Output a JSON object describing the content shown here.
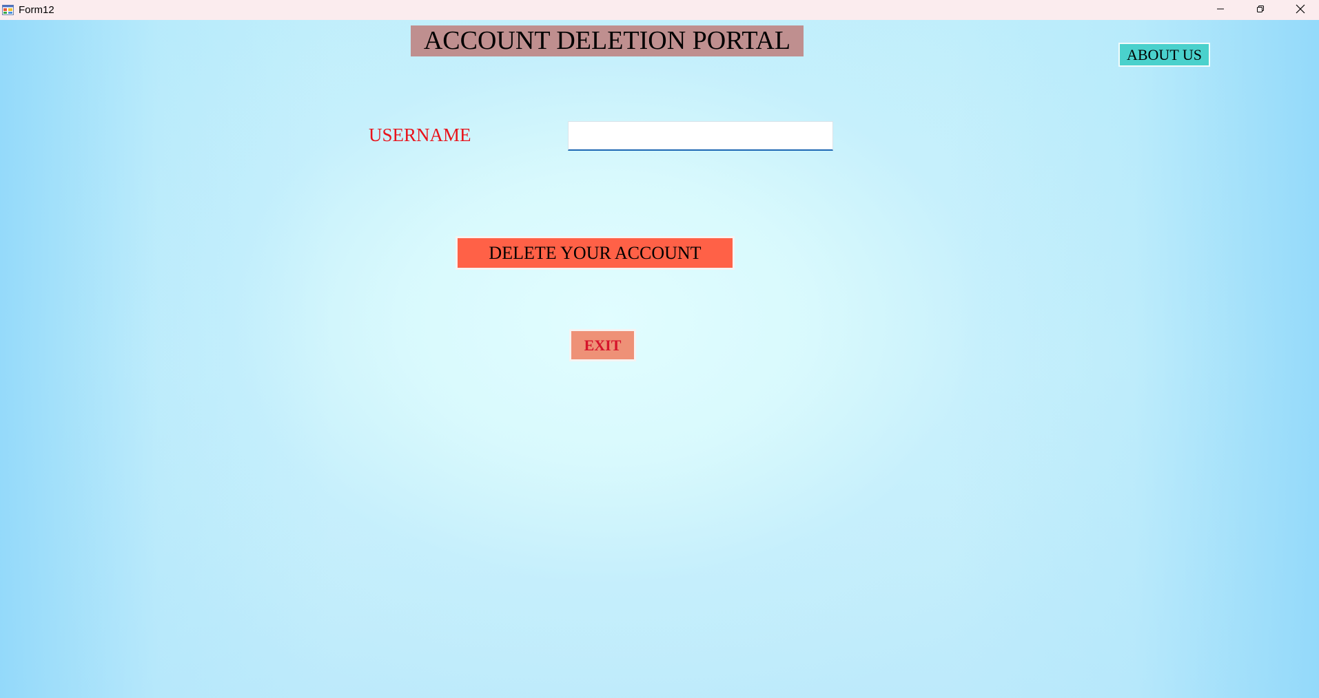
{
  "window": {
    "title": "Form12",
    "icon": "form-app-icon",
    "controls": {
      "minimize_icon": "minimize-icon",
      "maximize_icon": "restore-icon",
      "close_icon": "close-icon"
    }
  },
  "form": {
    "heading": "ACCOUNT DELETION PORTAL",
    "about_us_label": "ABOUT US",
    "username_label": "USERNAME",
    "username_value": "",
    "delete_label": "DELETE YOUR ACCOUNT",
    "exit_label": "EXIT"
  },
  "colors": {
    "heading_bg": "#bf8f8f",
    "about_bg": "#4ad1cc",
    "label_text": "#e8141c",
    "delete_bg": "#ff6147",
    "exit_bg": "#ee9177",
    "exit_text": "#d5142b",
    "input_underline": "#1b66b2"
  }
}
